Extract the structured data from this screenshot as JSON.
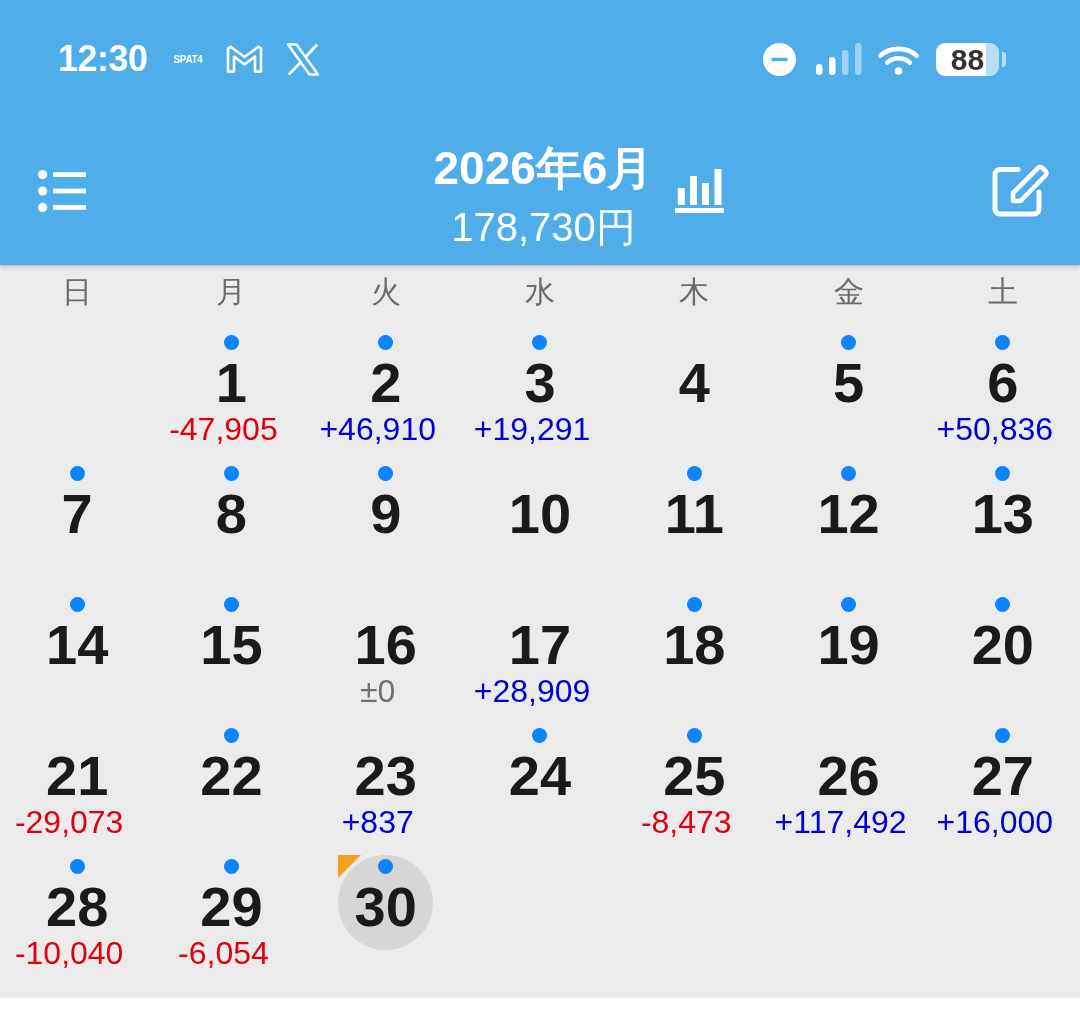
{
  "status_bar": {
    "time": "12:30",
    "app_label": "SPAT4",
    "battery": "88"
  },
  "header": {
    "title": "2026年6月",
    "total": "178,730円"
  },
  "weekdays": [
    "日",
    "月",
    "火",
    "水",
    "木",
    "金",
    "土"
  ],
  "weeks": [
    {
      "days": [
        {
          "day": "1",
          "marked": true,
          "selected": false,
          "today": false,
          "amount": {
            "text": "-47,905",
            "kind": "expense"
          }
        },
        {
          "day": "2",
          "marked": true,
          "selected": false,
          "today": false,
          "amount": {
            "text": "+46,910",
            "kind": "income"
          }
        },
        {
          "day": "3",
          "marked": true,
          "selected": false,
          "today": false,
          "amount": {
            "text": "+19,291",
            "kind": "income"
          }
        },
        {
          "day": "4",
          "marked": false,
          "selected": false,
          "today": false
        },
        {
          "day": "5",
          "marked": true,
          "selected": false,
          "today": false
        },
        {
          "day": "6",
          "marked": true,
          "selected": false,
          "today": false,
          "amount": {
            "text": "+50,836",
            "kind": "income"
          }
        }
      ]
    },
    {
      "days": [
        {
          "day": "7",
          "marked": true,
          "selected": false,
          "today": false
        },
        {
          "day": "8",
          "marked": true,
          "selected": false,
          "today": false
        },
        {
          "day": "9",
          "marked": true,
          "selected": false,
          "today": false
        },
        {
          "day": "10",
          "marked": false,
          "selected": false,
          "today": false
        },
        {
          "day": "11",
          "marked": true,
          "selected": false,
          "today": false
        },
        {
          "day": "12",
          "marked": true,
          "selected": false,
          "today": false
        },
        {
          "day": "13",
          "marked": true,
          "selected": false,
          "today": false
        }
      ]
    },
    {
      "days": [
        {
          "day": "14",
          "marked": true,
          "selected": false,
          "today": false
        },
        {
          "day": "15",
          "marked": true,
          "selected": false,
          "today": false
        },
        {
          "day": "16",
          "marked": false,
          "selected": false,
          "today": false,
          "amount": {
            "text": "±0",
            "kind": "zero"
          }
        },
        {
          "day": "17",
          "marked": false,
          "selected": false,
          "today": false,
          "amount": {
            "text": "+28,909",
            "kind": "income"
          }
        },
        {
          "day": "18",
          "marked": true,
          "selected": false,
          "today": false
        },
        {
          "day": "19",
          "marked": true,
          "selected": false,
          "today": false
        },
        {
          "day": "20",
          "marked": true,
          "selected": false,
          "today": false
        }
      ]
    },
    {
      "days": [
        {
          "day": "21",
          "marked": false,
          "selected": false,
          "today": false,
          "amount": {
            "text": "-29,073",
            "kind": "expense"
          }
        },
        {
          "day": "22",
          "marked": true,
          "selected": false,
          "today": false
        },
        {
          "day": "23",
          "marked": false,
          "selected": false,
          "today": false,
          "amount": {
            "text": "+837",
            "kind": "income"
          }
        },
        {
          "day": "24",
          "marked": true,
          "selected": false,
          "today": false
        },
        {
          "day": "25",
          "marked": true,
          "selected": false,
          "today": false,
          "amount": {
            "text": "-8,473",
            "kind": "expense"
          }
        },
        {
          "day": "26",
          "marked": false,
          "selected": false,
          "today": false,
          "amount": {
            "text": "+117,492",
            "kind": "income"
          }
        },
        {
          "day": "27",
          "marked": true,
          "selected": false,
          "today": false,
          "amount": {
            "text": "+16,000",
            "kind": "income"
          }
        }
      ]
    },
    {
      "days": [
        {
          "day": "28",
          "marked": true,
          "selected": false,
          "today": false,
          "amount": {
            "text": "-10,040",
            "kind": "expense"
          }
        },
        {
          "day": "29",
          "marked": true,
          "selected": false,
          "today": false,
          "amount": {
            "text": "-6,054",
            "kind": "expense"
          }
        },
        {
          "day": "30",
          "marked": true,
          "selected": true,
          "today": true
        }
      ]
    }
  ]
}
